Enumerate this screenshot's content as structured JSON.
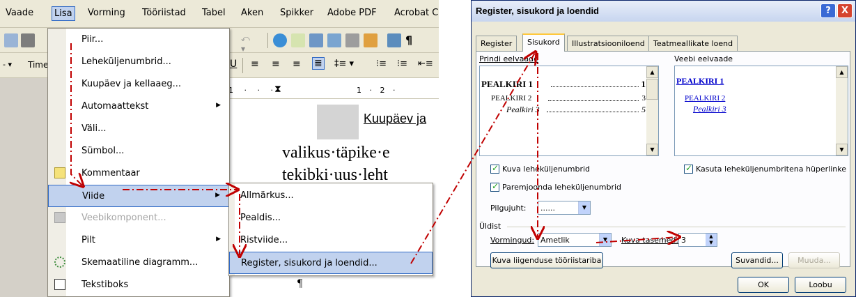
{
  "word": {
    "menubar": [
      "Vaade",
      "Lisa",
      "Vorming",
      "Tööriistad",
      "Tabel",
      "Aken",
      "Spikker",
      "Adobe PDF",
      "Acrobat C"
    ],
    "active_menu": "Lisa",
    "font_box": "Time",
    "ruler_text": "1 · 2 ·",
    "document": {
      "heading": "Kuupäev ja",
      "line1": "valikus·täpike·e",
      "line2": "tekibki·uus·leht",
      "pilcrow": "¶"
    },
    "lisa_menu": [
      {
        "label": "Piir...",
        "submenu": false,
        "enabled": true
      },
      {
        "label": "Leheküljenumbrid...",
        "submenu": false,
        "enabled": true
      },
      {
        "label": "Kuupäev ja kellaaeg...",
        "submenu": false,
        "enabled": true
      },
      {
        "label": "Automaattekst",
        "submenu": true,
        "enabled": true
      },
      {
        "label": "Väli...",
        "submenu": false,
        "enabled": true
      },
      {
        "label": "Sümbol...",
        "submenu": false,
        "enabled": true
      },
      {
        "label": "Kommentaar",
        "submenu": false,
        "enabled": true
      },
      {
        "label": "Viide",
        "submenu": true,
        "enabled": true,
        "highlighted": true
      },
      {
        "label": "Veebikomponent...",
        "submenu": false,
        "enabled": false
      },
      {
        "label": "Pilt",
        "submenu": true,
        "enabled": true
      },
      {
        "label": "Skemaatiline diagramm...",
        "submenu": false,
        "enabled": true
      },
      {
        "label": "Tekstiboks",
        "submenu": false,
        "enabled": true
      }
    ],
    "viide_submenu": [
      {
        "label": "Allmärkus..."
      },
      {
        "label": "Pealdis..."
      },
      {
        "label": "Ristviide..."
      },
      {
        "label": "Register, sisukord ja loendid...",
        "highlighted": true
      }
    ]
  },
  "dialog": {
    "title": "Register, sisukord ja loendid",
    "help_label": "?",
    "close_label": "X",
    "tabs": [
      "Register",
      "Sisukord",
      "Illustratsiooniloend",
      "Teatmeallikate loend"
    ],
    "active_tab": "Sisukord",
    "print_preview_label": "Prindi eelvaade",
    "web_preview_label": "Veebi eelvaade",
    "print_preview": [
      {
        "text": "PEALKIRI 1",
        "page": "1"
      },
      {
        "text": "PEALKIRI 2",
        "page": "3"
      },
      {
        "text": "Pealkiri 3",
        "page": "5"
      }
    ],
    "web_preview": [
      "PEALKIRI 1",
      "PEALKIRI 2",
      "Pealkiri 3"
    ],
    "show_page_numbers": "Kuva leheküljenumbrid",
    "right_align": "Paremjoonda leheküljenumbrid",
    "use_hyperlinks": "Kasuta leheküljenumbritena hüperlinke",
    "tab_leader_label": "Pilgujuht:",
    "tab_leader_value": "......",
    "general_label": "Üldist",
    "formats_label": "Vormingud:",
    "formats_value": "Ametlik",
    "levels_label": "Kuva tasemed:",
    "levels_value": "3",
    "outline_toolbar_btn": "Kuva liigenduse tööriistariba",
    "options_btn": "Suvandid...",
    "modify_btn": "Muuda...",
    "ok_btn": "OK",
    "cancel_btn": "Loobu"
  },
  "colors": {
    "annotation_arrow": "#c00000",
    "menu_highlight": "#c1d2ee",
    "hyperlink": "#0000cc"
  }
}
